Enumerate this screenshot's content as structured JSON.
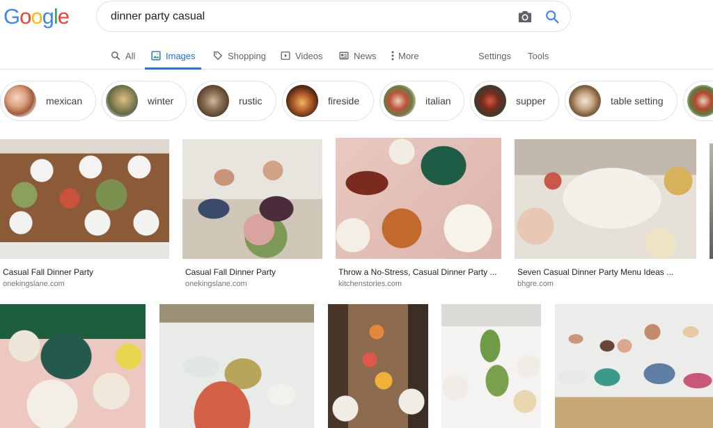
{
  "logo": {
    "letters": [
      "G",
      "o",
      "o",
      "g",
      "l",
      "e"
    ],
    "colors": [
      "#4285F4",
      "#EA4335",
      "#FBBC05",
      "#4285F4",
      "#34A853",
      "#EA4335"
    ]
  },
  "search": {
    "query": "dinner party casual",
    "camera_icon": "camera-icon",
    "search_icon": "search-icon"
  },
  "tabs": [
    {
      "label": "All",
      "icon": "search-icon",
      "active": false
    },
    {
      "label": "Images",
      "icon": "image-icon",
      "active": true
    },
    {
      "label": "Shopping",
      "icon": "tag-icon",
      "active": false
    },
    {
      "label": "Videos",
      "icon": "play-icon",
      "active": false
    },
    {
      "label": "News",
      "icon": "news-icon",
      "active": false
    },
    {
      "label": "More",
      "icon": "dots-vertical-icon",
      "active": false
    }
  ],
  "tools": {
    "settings": "Settings",
    "tools": "Tools"
  },
  "chips": [
    {
      "label": "mexican"
    },
    {
      "label": "winter"
    },
    {
      "label": "rustic"
    },
    {
      "label": "fireside"
    },
    {
      "label": "italian"
    },
    {
      "label": "supper"
    },
    {
      "label": "table setting"
    }
  ],
  "results_row1": [
    {
      "title": "Casual Fall Dinner Party",
      "source": "onekingslane.com"
    },
    {
      "title": "Casual Fall Dinner Party",
      "source": "onekingslane.com"
    },
    {
      "title": "Throw a No-Stress, Casual Dinner Party ...",
      "source": "kitchenstories.com"
    },
    {
      "title": "Seven Casual Dinner Party Menu Ideas ...",
      "source": "bhgre.com"
    }
  ],
  "colors": {
    "accent": "#1a73e8",
    "text": "#202124",
    "muted": "#70757a"
  }
}
